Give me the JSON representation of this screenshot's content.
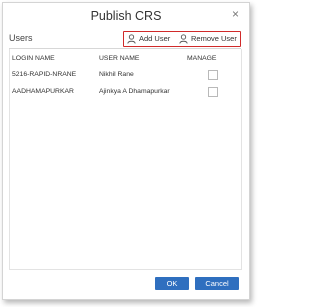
{
  "dialog": {
    "title": "Publish CRS",
    "close_glyph": "×",
    "section_label": "Users",
    "actions": {
      "add_user_label": "Add User",
      "add_user_icon": "user-icon",
      "remove_user_label": "Remove User",
      "remove_user_icon": "user-icon",
      "highlight_color": "#d02a2a"
    },
    "table": {
      "columns": [
        "LOGIN NAME",
        "USER NAME",
        "MANAGE"
      ],
      "rows": [
        {
          "login": "5216-RAPID-NRANE",
          "user": "Nikhil Rane",
          "manage_checked": false
        },
        {
          "login": "AADHAMAPURKAR",
          "user": "Ajinkya A Dhamapurkar",
          "manage_checked": false
        }
      ]
    },
    "buttons": {
      "ok_label": "OK",
      "cancel_label": "Cancel",
      "color": "#2f6fbf"
    }
  }
}
